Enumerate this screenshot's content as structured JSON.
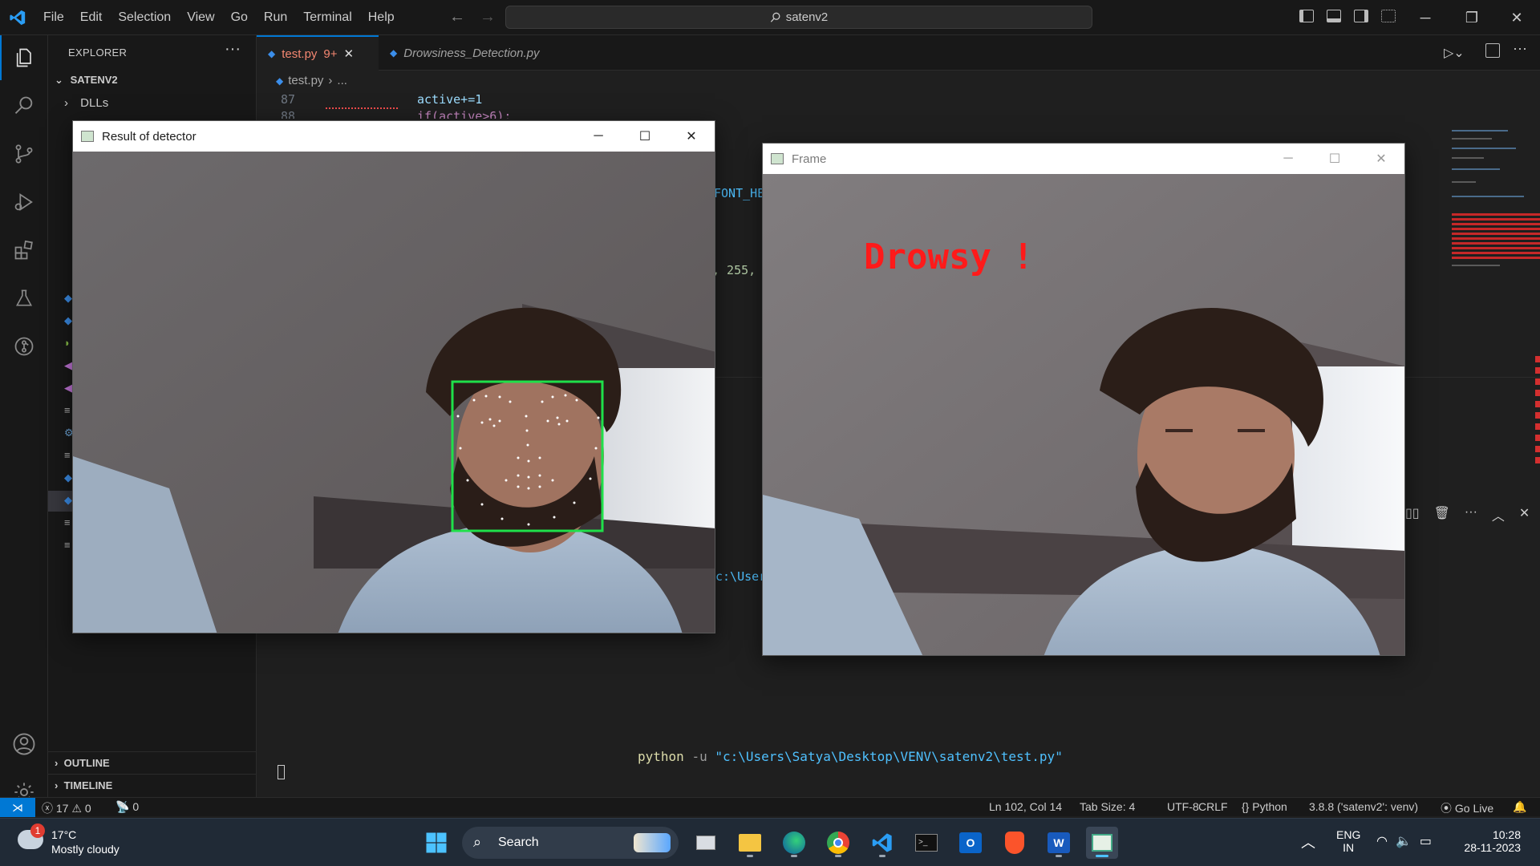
{
  "titlebar": {
    "menu": [
      "File",
      "Edit",
      "Selection",
      "View",
      "Go",
      "Run",
      "Terminal",
      "Help"
    ],
    "command_center": "satenv2"
  },
  "sidebar": {
    "title": "EXPLORER",
    "folder": "SATENV2",
    "items": [
      {
        "label": "DLLs"
      }
    ],
    "sections": [
      "OUTLINE",
      "TIMELINE"
    ]
  },
  "editor": {
    "tabs": [
      {
        "label": "test.py",
        "badge": "9+",
        "active": true
      },
      {
        "label": "Drowsiness_Detection.py",
        "active": false
      }
    ],
    "breadcrumb": [
      "test.py",
      "..."
    ],
    "code_lines": [
      {
        "num": "87",
        "text": "active+=1"
      },
      {
        "num": "88",
        "text": "if(active>6):"
      }
    ],
    "fragments": {
      "font": "FONT_HE",
      "color": ", 255,",
      "path": "c:\\User"
    },
    "terminal_command": {
      "cmd": "python",
      "flag": "-u",
      "path": "\"c:\\Users\\Satya\\Desktop\\VENV\\satenv2\\test.py\""
    }
  },
  "windows": {
    "detector": {
      "title": "Result of detector"
    },
    "frame": {
      "title": "Frame",
      "overlay_text": "Drowsy !"
    }
  },
  "status": {
    "errors": "17",
    "warnings": "0",
    "ports": "0",
    "position": "Ln 102, Col 14",
    "tab_size": "Tab Size: 4",
    "encoding": "UTF-8",
    "eol": "CRLF",
    "language": "Python",
    "interpreter": "3.8.8 ('satenv2': venv)",
    "golive": "Go Live"
  },
  "taskbar": {
    "weather_temp": "17°C",
    "weather_desc": "Mostly cloudy",
    "weather_badge": "1",
    "search": "Search",
    "lang_top": "ENG",
    "lang_bottom": "IN",
    "time": "10:28",
    "date": "28-11-2023"
  },
  "colors": {
    "accent": "#0078d4",
    "drowsy_text": "#ff1a1a",
    "face_box": "#1fe04a",
    "terminal_yellow": "#dcdcaa",
    "terminal_string": "#4fc1ff"
  }
}
